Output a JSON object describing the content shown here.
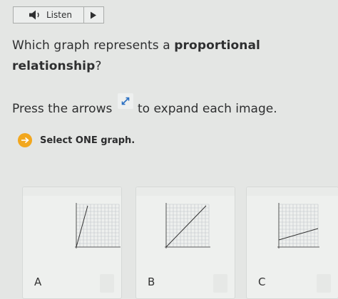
{
  "listen": {
    "label": "Listen"
  },
  "question": {
    "prefix": "Which graph represents a ",
    "bold1": "proportional",
    "bold2": "relationship",
    "suffix": "?"
  },
  "instructions": {
    "before": "Press the arrows",
    "after": "to expand each image."
  },
  "select_prompt": "Select ONE graph.",
  "options": [
    {
      "letter": "A"
    },
    {
      "letter": "B"
    },
    {
      "letter": "C"
    }
  ],
  "colors": {
    "accent": "#f2a71e",
    "icon_blue": "#2a6fc2"
  }
}
